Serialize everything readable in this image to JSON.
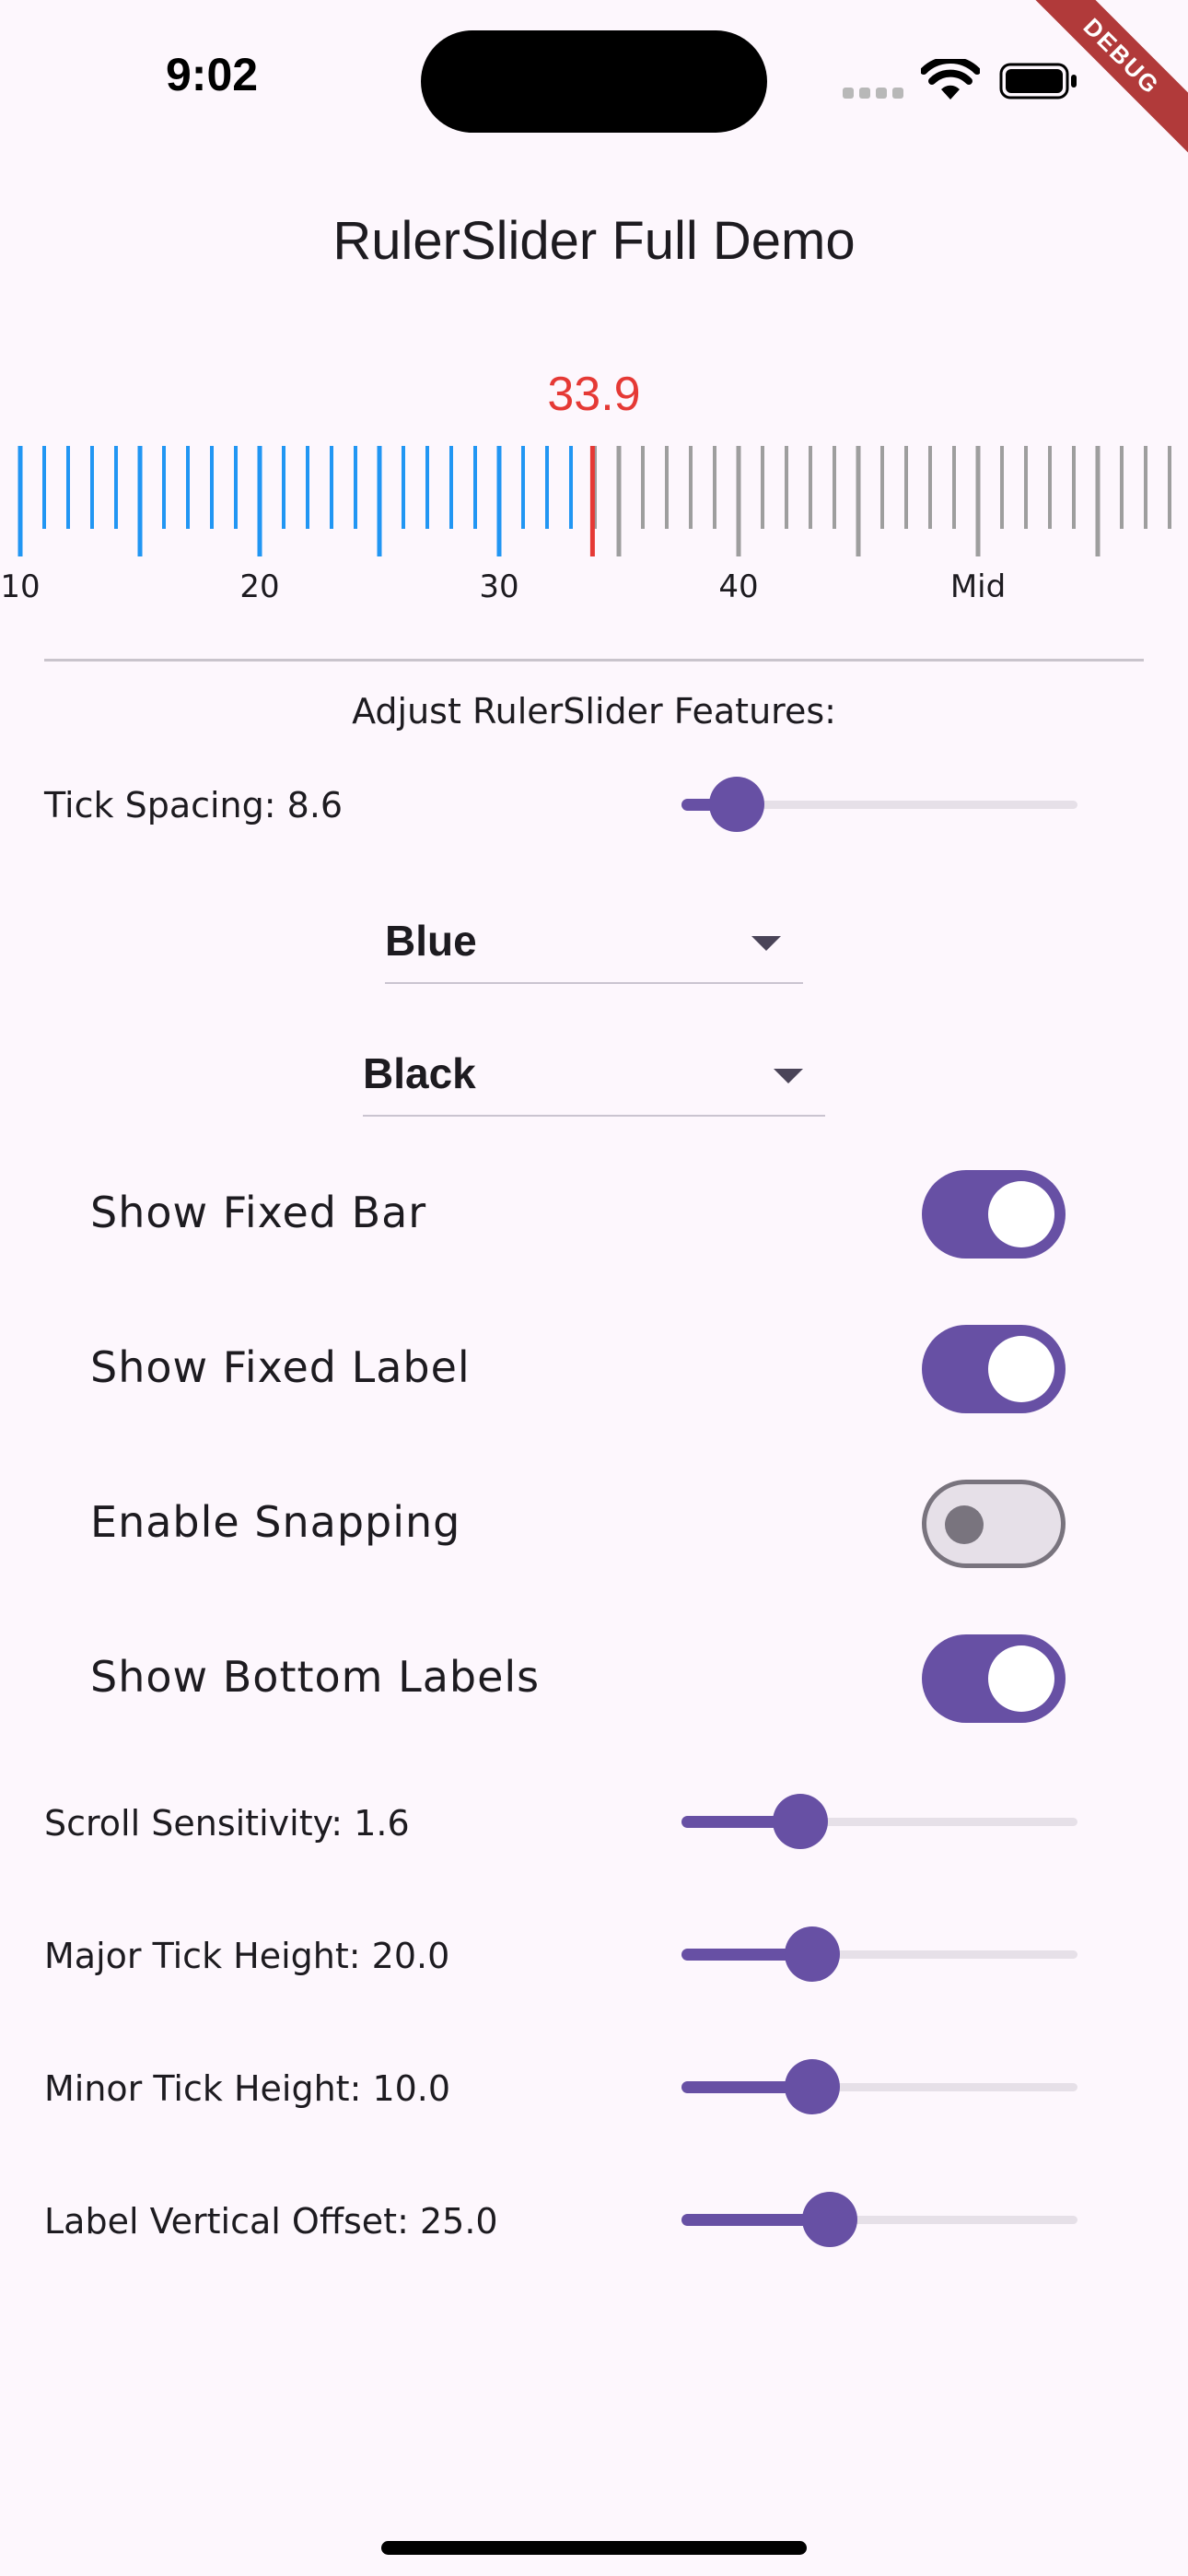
{
  "status_bar": {
    "time": "9:02",
    "debug_banner": "DEBUG"
  },
  "app_bar": {
    "title": "RulerSlider Full Demo"
  },
  "ruler": {
    "current_value": "33.9",
    "value": 33.9,
    "visible_min": 9.6,
    "visible_max": 58.8,
    "major_every": 5,
    "minor_step": 1,
    "bottom_labels": [
      {
        "value": 10,
        "text": "10"
      },
      {
        "value": 20,
        "text": "20"
      },
      {
        "value": 30,
        "text": "30"
      },
      {
        "value": 40,
        "text": "40"
      },
      {
        "value": 50,
        "text": "Mid"
      }
    ],
    "colors": {
      "active_tick": "#2196f3",
      "inactive_tick": "#9e9e9e",
      "fixed_bar": "#e53935",
      "label": "#1d1b20"
    }
  },
  "controls": {
    "heading": "Adjust RulerSlider Features:",
    "tick_spacing": {
      "label": "Tick Spacing: 8.6",
      "fraction": 0.14
    },
    "tick_color_dropdown": {
      "value": "Blue"
    },
    "label_color_dropdown": {
      "value": "Black"
    },
    "switches": [
      {
        "label": "Show Fixed Bar",
        "on": true
      },
      {
        "label": "Show Fixed Label",
        "on": true
      },
      {
        "label": "Enable Snapping",
        "on": false
      },
      {
        "label": "Show Bottom Labels",
        "on": true
      }
    ],
    "scroll_sensitivity": {
      "label": "Scroll Sensitivity: 1.6",
      "fraction": 0.3
    },
    "major_tick_height": {
      "label": "Major Tick Height: 20.0",
      "fraction": 0.33
    },
    "minor_tick_height": {
      "label": "Minor Tick Height: 10.0",
      "fraction": 0.33
    },
    "label_vertical_offset": {
      "label": "Label Vertical Offset: 25.0",
      "fraction": 0.375
    }
  },
  "colors": {
    "accent": "#6750a4",
    "background": "#fdf7fd",
    "track": "#e6e0e8"
  }
}
